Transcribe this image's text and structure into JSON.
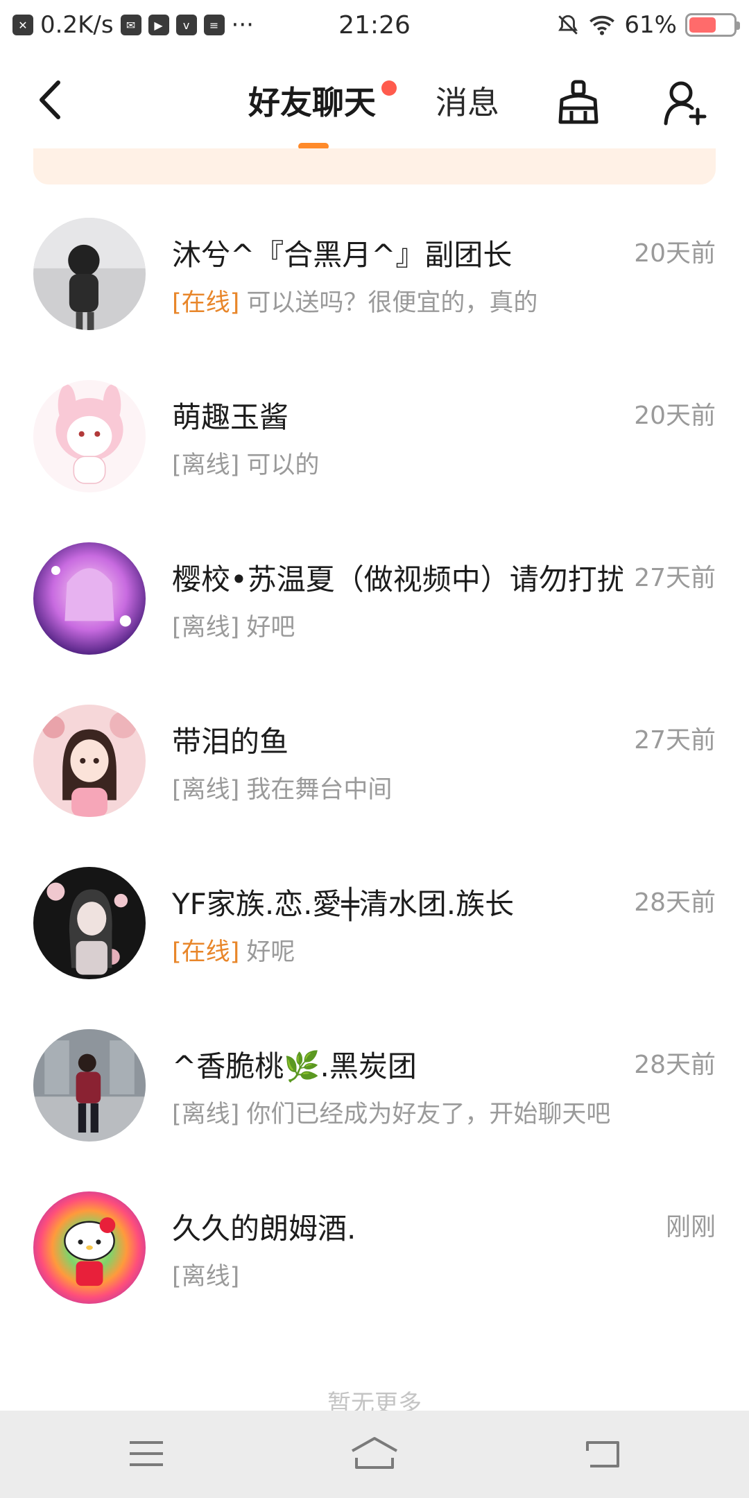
{
  "status_bar": {
    "net_speed": "0.2K/s",
    "time": "21:26",
    "battery": "61%",
    "battery_level": 0.61,
    "more": "···"
  },
  "header": {
    "tabs": [
      {
        "label": "好友聊天",
        "active": true,
        "has_badge": true
      },
      {
        "label": "消息",
        "active": false
      }
    ],
    "icons": [
      "back-arrow-icon",
      "broom-clean-icon",
      "add-friend-icon"
    ],
    "accent_color": "#ff8a2a",
    "badge_color": "#ff5b4d"
  },
  "friends": [
    {
      "name": "沐兮^『合黑月^』副团长",
      "time": "20天前",
      "status": "[在线]",
      "online": true,
      "message": "可以送吗？很便宜的，真的"
    },
    {
      "name": "萌趣玉酱",
      "time": "20天前",
      "status": "[离线]",
      "online": false,
      "message": "可以的"
    },
    {
      "name": "樱校•苏温夏（做视频中）请勿打扰",
      "time": "27天前",
      "status": "[离线]",
      "online": false,
      "message": "好吧"
    },
    {
      "name": "带泪的鱼",
      "time": "27天前",
      "status": "[离线]",
      "online": false,
      "message": "我在舞台中间"
    },
    {
      "name": "YF家族.恋.愛╪清水团.族长",
      "time": "28天前",
      "status": "[在线]",
      "online": true,
      "message": "好呢"
    },
    {
      "name": "^香脆桃🌿.黑炭团",
      "time": "28天前",
      "status": "[离线]",
      "online": false,
      "message": "你们已经成为好友了，开始聊天吧"
    },
    {
      "name": "久久的朗姆酒.",
      "time": "刚刚",
      "status": "[离线]",
      "online": false,
      "message": ""
    }
  ],
  "footer": {
    "no_more": "暂无更多"
  },
  "colors": {
    "online": "#e8862a",
    "offline": "#9a9a9a",
    "banner": "#fff1e6"
  }
}
